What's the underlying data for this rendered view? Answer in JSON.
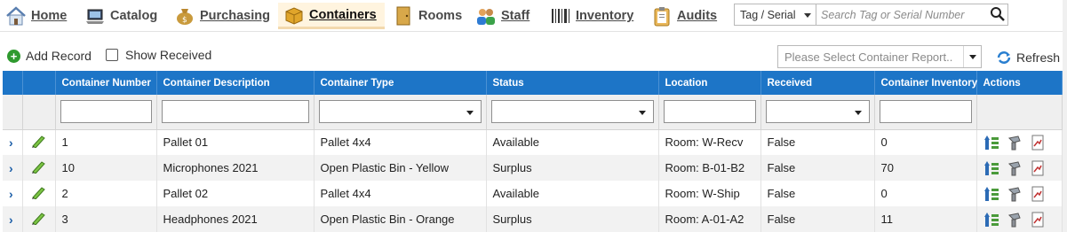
{
  "nav": {
    "items": [
      {
        "label": "Home",
        "icon": "home-icon",
        "active": false
      },
      {
        "label": "Catalog",
        "icon": "laptop-icon",
        "active": false
      },
      {
        "label": "Purchasing",
        "icon": "money-bag-icon",
        "active": false
      },
      {
        "label": "Containers",
        "icon": "box-icon",
        "active": true
      },
      {
        "label": "Rooms",
        "icon": "door-icon",
        "active": false
      },
      {
        "label": "Staff",
        "icon": "people-icon",
        "active": false
      },
      {
        "label": "Inventory",
        "icon": "barcode-icon",
        "active": false
      },
      {
        "label": "Audits",
        "icon": "clipboard-icon",
        "active": false
      }
    ],
    "search_type": "Tag / Serial",
    "search_placeholder": "Search Tag or Serial Number"
  },
  "toolbar": {
    "add_record": "Add Record",
    "show_received": "Show Received",
    "show_received_checked": false,
    "report_placeholder": "Please Select Container Report..",
    "refresh": "Refresh"
  },
  "grid": {
    "columns": [
      "Container Number",
      "Container Description",
      "Container Type",
      "Status",
      "Location",
      "Received",
      "Container Inventory",
      "Actions"
    ],
    "rows": [
      {
        "number": "1",
        "description": "Pallet 01",
        "type": "Pallet 4x4",
        "status": "Available",
        "location": "Room: W-Recv",
        "received": "False",
        "inventory": "0"
      },
      {
        "number": "10",
        "description": "Microphones 2021",
        "type": "Open Plastic Bin - Yellow",
        "status": "Surplus",
        "location": "Room: B-01-B2",
        "received": "False",
        "inventory": "70"
      },
      {
        "number": "2",
        "description": "Pallet 02",
        "type": "Pallet 4x4",
        "status": "Available",
        "location": "Room: W-Ship",
        "received": "False",
        "inventory": "0"
      },
      {
        "number": "3",
        "description": "Headphones 2021",
        "type": "Open Plastic Bin - Orange",
        "status": "Surplus",
        "location": "Room: A-01-A2",
        "received": "False",
        "inventory": "11"
      }
    ]
  },
  "colors": {
    "header_blue": "#1d75c7",
    "active_tab_bg": "#fff4df",
    "add_green": "#2f9a2f"
  }
}
